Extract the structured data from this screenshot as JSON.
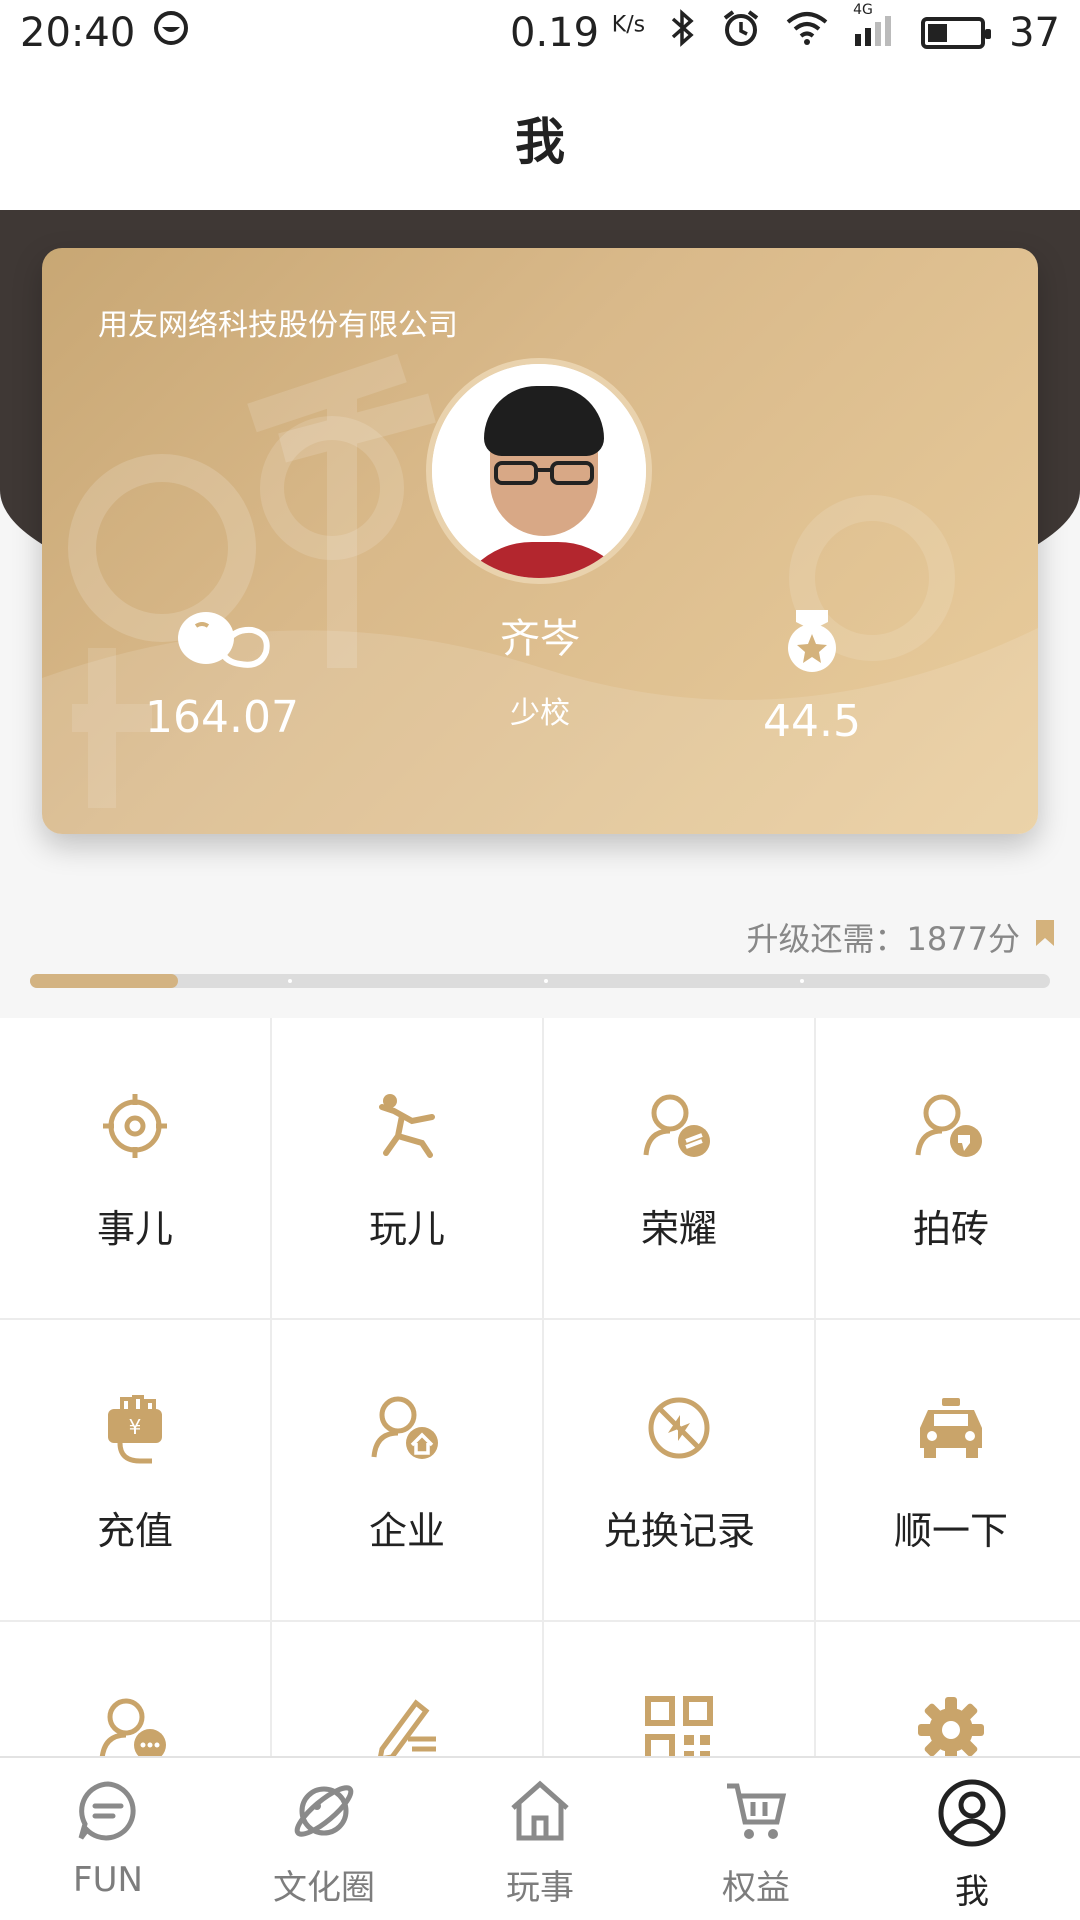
{
  "status_bar": {
    "time": "20:40",
    "speed_value": "0.19",
    "speed_unit": "K/s",
    "network": "4G",
    "battery_level": "37"
  },
  "header": {
    "title": "我"
  },
  "card": {
    "company": "用友网络科技股份有限公司",
    "name": "齐岑",
    "rank": "少校",
    "beans_value": "164.07",
    "medal_value": "44.5"
  },
  "progress": {
    "upgrade_label": "升级还需：1877分",
    "fill_fraction": 0.145
  },
  "grid": {
    "items": [
      {
        "label": "事儿",
        "icon": "target-icon"
      },
      {
        "label": "玩儿",
        "icon": "dancer-icon"
      },
      {
        "label": "荣耀",
        "icon": "user-medal-icon"
      },
      {
        "label": "拍砖",
        "icon": "user-thumbsdown-icon"
      },
      {
        "label": "充值",
        "icon": "wallet-icon"
      },
      {
        "label": "企业",
        "icon": "user-home-icon"
      },
      {
        "label": "兑换记录",
        "icon": "exchange-icon"
      },
      {
        "label": "顺一下",
        "icon": "taxi-icon"
      },
      {
        "label": "",
        "icon": "user-chat-icon"
      },
      {
        "label": "",
        "icon": "edit-icon"
      },
      {
        "label": "",
        "icon": "qrcode-icon"
      },
      {
        "label": "",
        "icon": "gear-icon"
      }
    ]
  },
  "bottom_nav": {
    "items": [
      {
        "label": "FUN",
        "icon": "chat-bubble-icon"
      },
      {
        "label": "文化圈",
        "icon": "planet-icon"
      },
      {
        "label": "玩事",
        "icon": "home-icon"
      },
      {
        "label": "权益",
        "icon": "cart-icon"
      },
      {
        "label": "我",
        "icon": "user-icon"
      }
    ],
    "active_index": 4
  },
  "colors": {
    "accent": "#c9a46a",
    "card_start": "#c8a774",
    "card_end": "#e9cd9d",
    "header_dark": "#3f3835"
  }
}
